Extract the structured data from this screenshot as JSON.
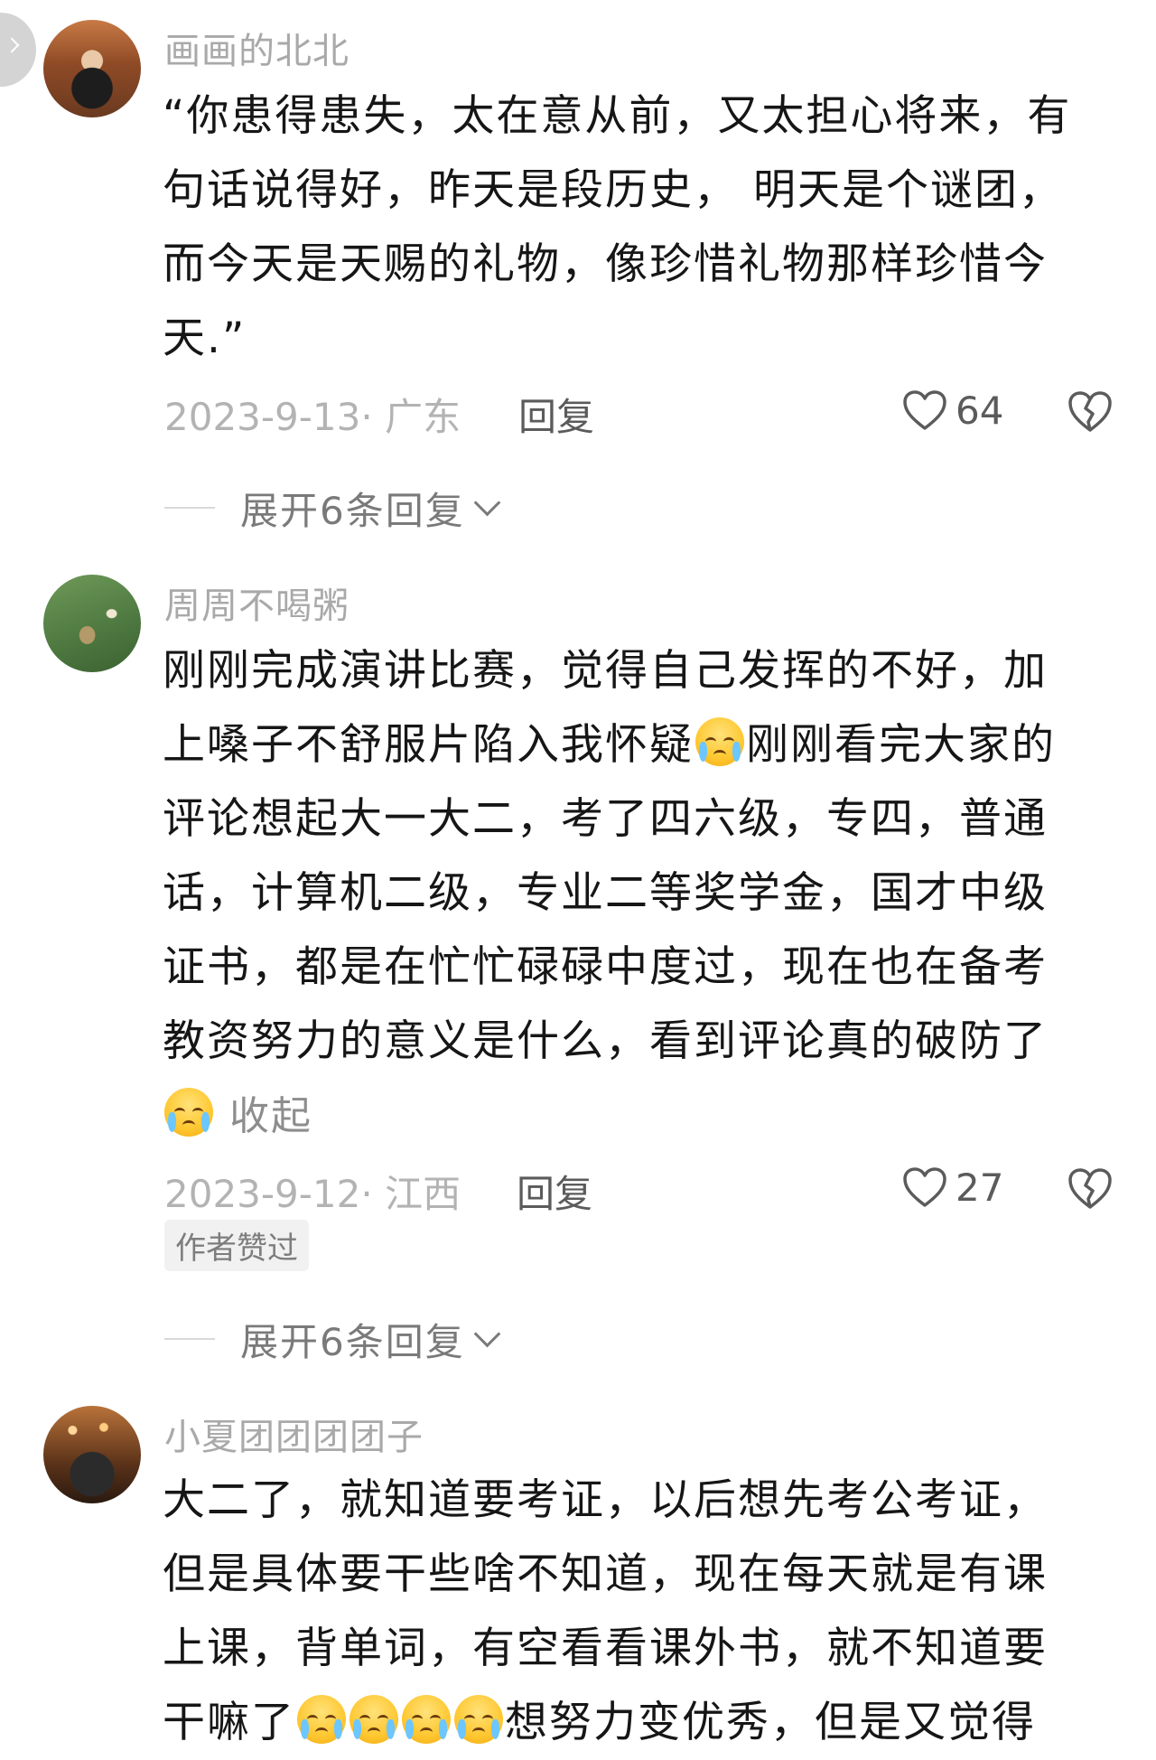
{
  "comments": [
    {
      "username": "画画的北北",
      "lines": [
        "“你患得患失，太在意从前，又太担心将来，有",
        "句话说得好，昨天是段历史， 明天是个谜团，",
        "而今天是天赐的礼物，像珍惜礼物那样珍惜今",
        "天.”"
      ],
      "meta": "2023-9-13· 广东",
      "reply_label": "回复",
      "like_count": "64",
      "expand_label": "展开6条回复"
    },
    {
      "username": "周周不喝粥",
      "lines": [
        "刚刚完成演讲比赛，觉得自己发挥的不好，加",
        "上嗓子不舒服片陷入我怀疑",
        "刚刚看完大家的",
        "评论想起大一大二，考了四六级，专四，普通",
        "话，计算机二级，专业二等奖学金，国才中级",
        "证书，都是在忙忙碌碌中度过，现在也在备考",
        "教资努力的意义是什么，看到评论真的破防了"
      ],
      "collapse_label": "收起",
      "meta": "2023-9-12· 江西",
      "reply_label": "回复",
      "like_count": "27",
      "badge": "作者赞过",
      "expand_label": "展开6条回复"
    },
    {
      "username": "小夏团团团团子",
      "lines": [
        "大二了，就知道要考证，以后想先考公考证，",
        "但是具体要干些啥不知道，现在每天就是有课",
        "上课，背单词，有空看看课外书，就不知道要",
        "干嘛了",
        "想努力变优秀，但是又觉得"
      ]
    }
  ],
  "icons": {
    "avatar_1": "avatar",
    "like": "heart-outline-icon",
    "dislike": "broken-heart-icon",
    "emoji": "crying-face-emoji",
    "expand": "chevron-down-icon",
    "side": "chevron-right-icon"
  },
  "colors": {
    "text": "#161616",
    "muted": "#a9a9a9",
    "reply": "#5b5b5b"
  }
}
